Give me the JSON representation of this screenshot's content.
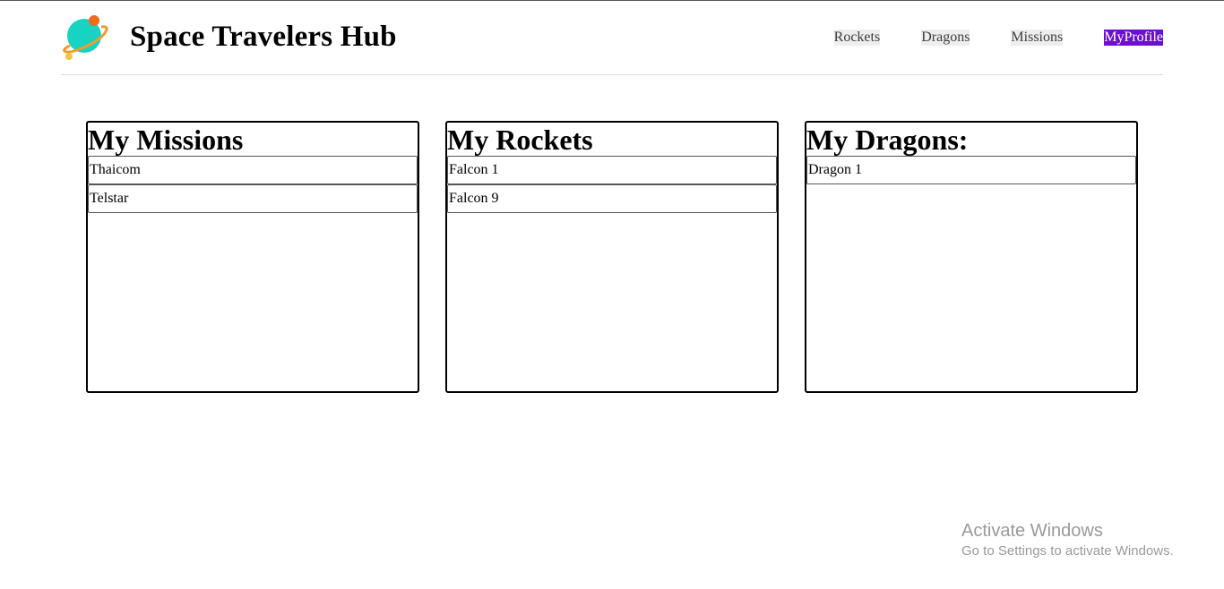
{
  "header": {
    "brand": "Space Travelers Hub",
    "logo_icon": "planet-icon",
    "nav": [
      {
        "label": "Rockets"
      },
      {
        "label": "Dragons"
      },
      {
        "label": "Missions"
      },
      {
        "label": "MyProfile",
        "active": true
      }
    ],
    "active_color": "#6b10cf"
  },
  "panels": {
    "missions": {
      "title": "My Missions",
      "items": [
        "Thaicom",
        "Telstar"
      ]
    },
    "rockets": {
      "title": "My Rockets",
      "items": [
        "Falcon 1",
        "Falcon 9"
      ]
    },
    "dragons": {
      "title": "My Dragons:",
      "items": [
        "Dragon 1"
      ]
    }
  },
  "watermark": {
    "title": "Activate Windows",
    "subtitle": "Go to Settings to activate Windows."
  }
}
